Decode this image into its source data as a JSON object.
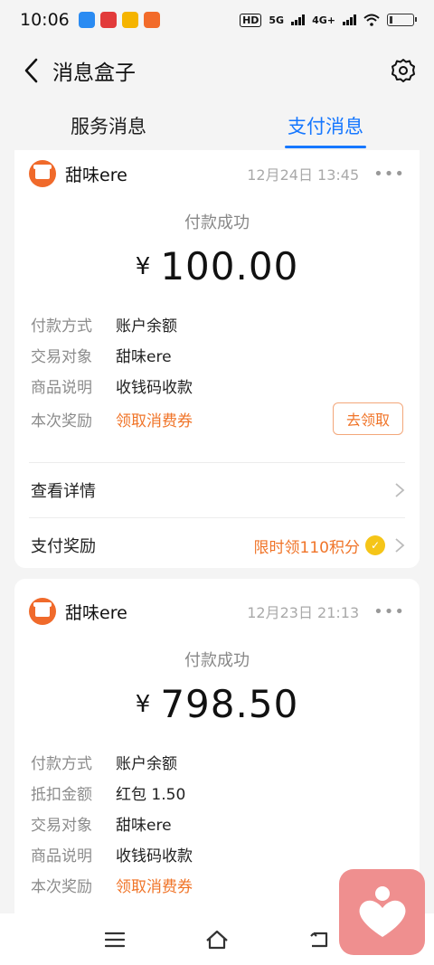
{
  "status_bar": {
    "time": "10:06",
    "hd_label": "HD",
    "net1": "5G",
    "net2": "4G+"
  },
  "header": {
    "title": "消息盒子"
  },
  "tabs": [
    {
      "label": "服务消息",
      "active": false
    },
    {
      "label": "支付消息",
      "active": true
    }
  ],
  "cards": [
    {
      "merchant": "甜味ere",
      "time": "12月24日 13:45",
      "status": "付款成功",
      "currency": "¥",
      "amount": "100.00",
      "rows": [
        {
          "label": "付款方式",
          "value": "账户余额"
        },
        {
          "label": "交易对象",
          "value": "甜味ere"
        },
        {
          "label": "商品说明",
          "value": "收钱码收款"
        },
        {
          "label": "本次奖励",
          "value": "领取消费券",
          "button": "去领取"
        }
      ],
      "details_label": "查看详情",
      "reward_label": "支付奖励",
      "reward_text": "限时领110积分"
    },
    {
      "merchant": "甜味ere",
      "time": "12月23日 21:13",
      "status": "付款成功",
      "currency": "¥",
      "amount": "798.50",
      "rows": [
        {
          "label": "付款方式",
          "value": "账户余额"
        },
        {
          "label": "抵扣金额",
          "value": "红包 1.50"
        },
        {
          "label": "交易对象",
          "value": "甜味ere"
        },
        {
          "label": "商品说明",
          "value": "收钱码收款"
        },
        {
          "label": "本次奖励",
          "value": "领取消费券"
        }
      ]
    }
  ],
  "colors": {
    "accent": "#1677ff",
    "orange": "#f07428",
    "merchant_logo": "#f06a2b"
  }
}
